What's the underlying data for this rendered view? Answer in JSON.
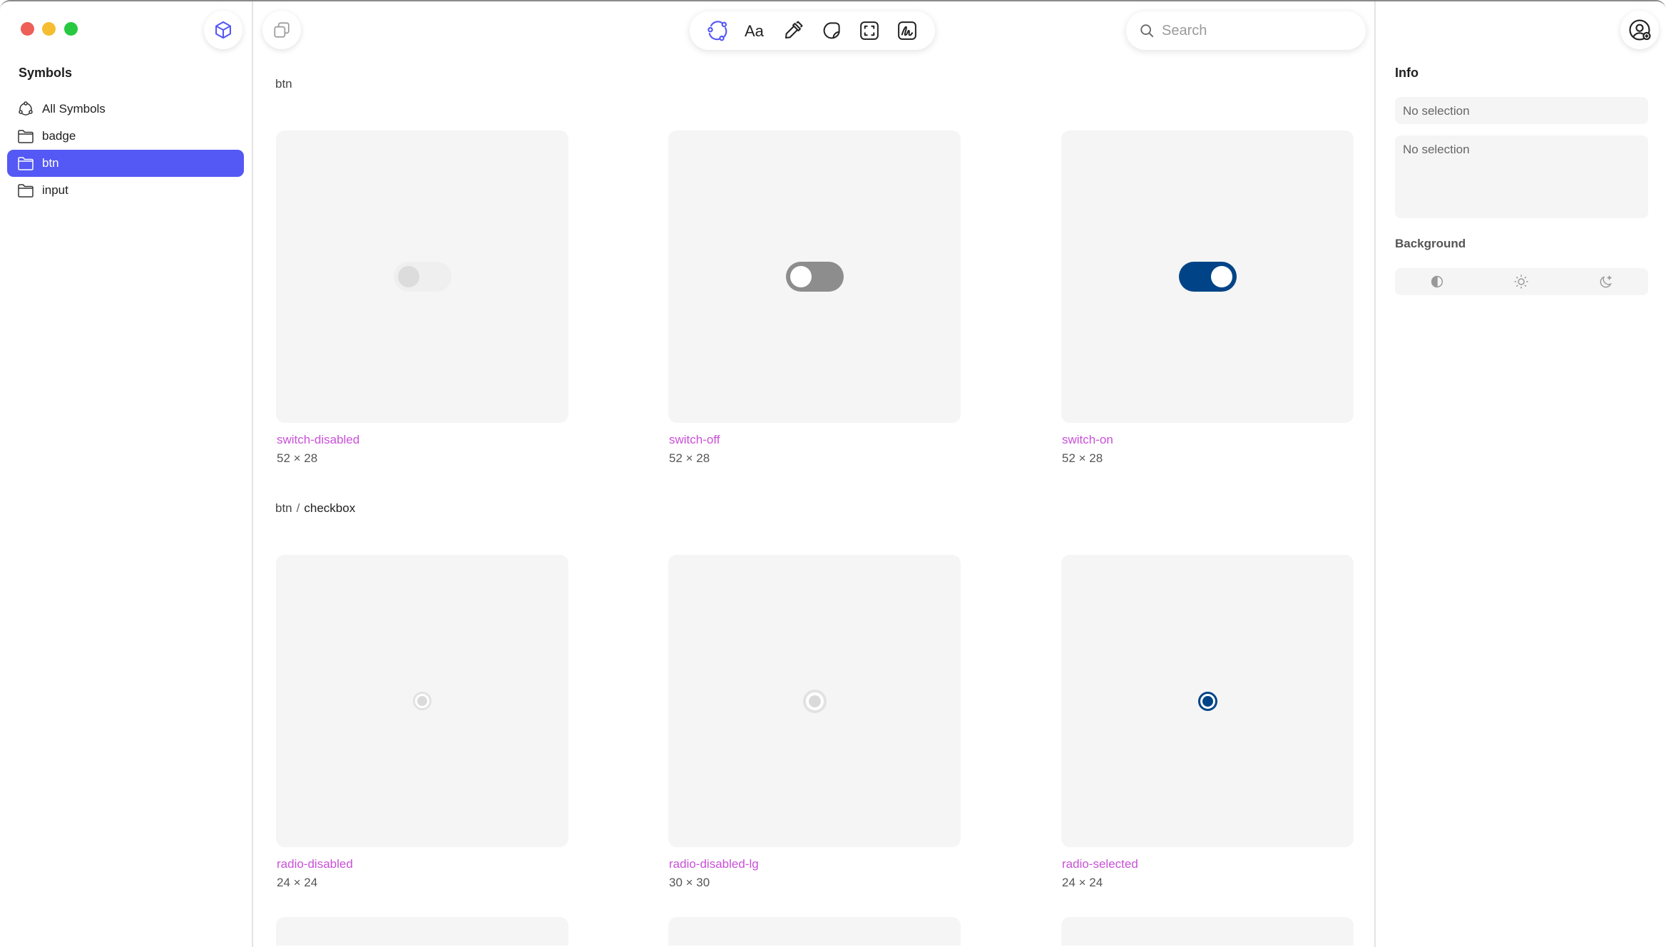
{
  "sidebar": {
    "title": "Symbols",
    "items": [
      {
        "label": "All Symbols",
        "icon": "all-symbols-icon"
      },
      {
        "label": "badge",
        "icon": "folder-icon"
      },
      {
        "label": "btn",
        "icon": "folder-icon",
        "active": true
      },
      {
        "label": "input",
        "icon": "folder-icon"
      }
    ]
  },
  "toolbar": {
    "tools": [
      "symbols-tool-icon",
      "text-tool-icon",
      "color-picker-icon",
      "sticker-icon",
      "frame-icon",
      "signature-icon"
    ]
  },
  "search": {
    "placeholder": "Search"
  },
  "groups": [
    {
      "title": "btn",
      "items": [
        {
          "name": "switch-disabled",
          "size": "52 × 28"
        },
        {
          "name": "switch-off",
          "size": "52 × 28"
        },
        {
          "name": "switch-on",
          "size": "52 × 28"
        }
      ]
    },
    {
      "title_parent": "btn",
      "title_sep": "/",
      "title_child": "checkbox",
      "items": [
        {
          "name": "radio-disabled",
          "size": "24 × 24"
        },
        {
          "name": "radio-disabled-lg",
          "size": "30 × 30"
        },
        {
          "name": "radio-selected",
          "size": "24 × 24"
        }
      ]
    }
  ],
  "inspector": {
    "title": "Info",
    "name_field": "No selection",
    "notes_field": "No selection",
    "background_label": "Background",
    "background_options": [
      "auto-contrast-icon",
      "light-mode-icon",
      "dark-mode-icon"
    ]
  },
  "colors": {
    "accent": "#5458f5",
    "symbol_name": "#c950d8",
    "switch_on": "#004487",
    "tile_bg": "#f5f5f5"
  }
}
